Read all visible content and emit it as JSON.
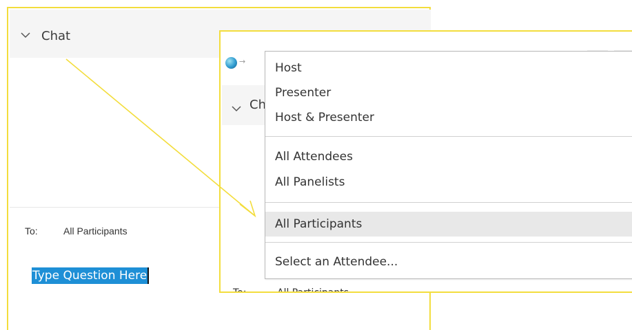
{
  "left_panel": {
    "chat_title": "Chat",
    "to_label": "To:",
    "to_value": "All Participants",
    "message_input_value": "Type Question Here"
  },
  "right_panel": {
    "chat_title_partial": "Ch",
    "to_hint": "To:",
    "to_value_hint": "All Participants"
  },
  "recipient_menu": {
    "items": [
      "Host",
      "Presenter",
      "Host & Presenter",
      "All Attendees",
      "All Panelists",
      "All Participants",
      "Select an Attendee..."
    ],
    "selected": "All Participants"
  },
  "icons": {
    "chevron": "chevron-down-icon",
    "app": "webex-app-icon",
    "arrow": "arrow-right-icon"
  },
  "colors": {
    "annotation": "#f3dd3c",
    "selection": "#1e8fd6",
    "menu_selected": "#e8e8e8"
  }
}
